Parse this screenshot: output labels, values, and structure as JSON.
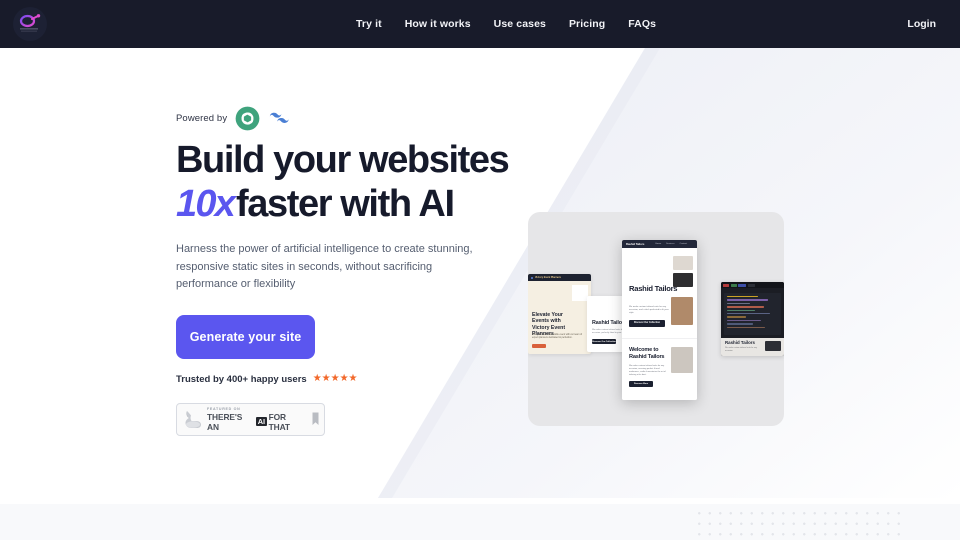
{
  "theme": {
    "nav_bg": "#181b2a",
    "accent_purple": "#5b56ef",
    "headline_color": "#161a2b",
    "star_color": "#f2682a",
    "panel_bg": "#e6e6e8",
    "bottom_band_bg": "#f8f9fb",
    "body_bg": "#ffffff"
  },
  "navbar": {
    "logo_name": "brand-logo-icon",
    "links": [
      {
        "label": "Try it"
      },
      {
        "label": "How it works"
      },
      {
        "label": "Use cases"
      },
      {
        "label": "Pricing"
      },
      {
        "label": "FAQs"
      }
    ],
    "login_label": "Login"
  },
  "hero": {
    "powered_by": {
      "label": "Powered by",
      "badges": [
        {
          "name": "openai-icon",
          "color": "#3fa37d"
        },
        {
          "name": "tailwindcss-icon",
          "color": "#4a7fd4"
        }
      ]
    },
    "headline_line1": "Build your websites",
    "headline_accent": "10x",
    "headline_line2_rest": "faster with AI",
    "subtext": "Harness the power of artificial intelligence to create stunning, responsive static sites in seconds, without sacrificing performance or flexibility",
    "cta_label": "Generate your site",
    "trust_text": "Trusted by 400+ happy users",
    "stars": "★★★★★",
    "star_count": 5,
    "featured_badge": {
      "eyebrow": "FEATURED ON",
      "word1": "THERE'S AN",
      "ai": "AI",
      "word2": "FOR THAT",
      "arm_icon": "flexed-arm-icon",
      "bookmark_icon": "bookmark-icon"
    }
  },
  "showcase": {
    "panel_name": "site-previews-panel",
    "cream_card": {
      "bar_title": "Victory Event Planners",
      "heading": "Elevate Your Events with Victory Event Planners",
      "paragraph": "Plan your next memorable event with our team of expert planners dedicated to perfection.",
      "button_label": "Get Started"
    },
    "white_card": {
      "heading": "Rashid Tailors",
      "paragraph": "We make custom tailored suits for any occasion, perfectly fitted to your style.",
      "button_label": "Discover Our Collection"
    },
    "phone": {
      "brand": "Rashid Tailors",
      "nav": [
        "Home",
        "Services",
        "Contact"
      ],
      "hero_heading": "Rashid Tailors",
      "hero_paragraph": "We make custom tailored suits for any occasion, each stitch perfected to fit your style.",
      "hero_button": "Discover Our Collection",
      "section_heading": "Welcome to Rashid Tailors",
      "section_paragraph": "We make custom tailored suits for any occasion, ensuring perfect fit and endurance, crafts characterize the art of tailoring at its best.",
      "section_button": "Discover More"
    },
    "code_editor": {
      "heading": "Rashid Tailors",
      "paragraph": "We make custom tailored suits for any occasion."
    }
  },
  "footer": {
    "dot_grid_name": "dot-grid-pattern"
  }
}
